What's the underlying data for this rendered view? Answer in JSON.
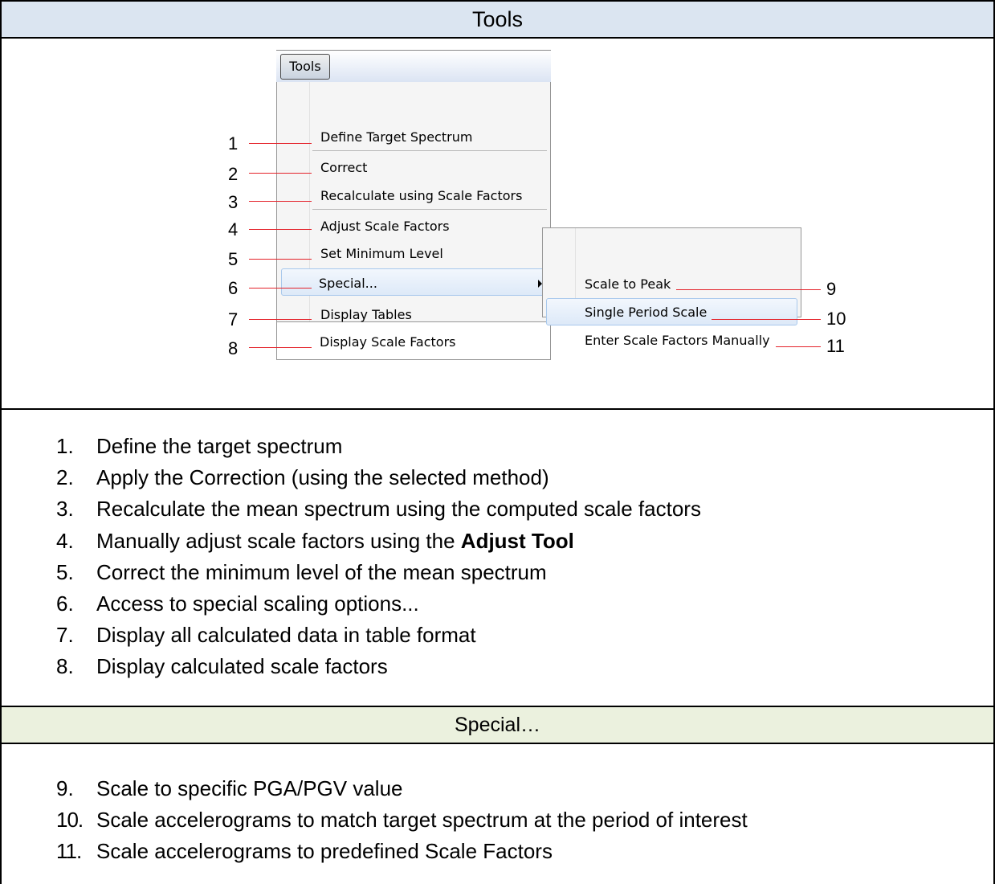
{
  "tools_header": "Tools",
  "special_header": "Special…",
  "menu": {
    "button": "Tools",
    "items": [
      "Define Target Spectrum",
      "Correct",
      "Recalculate using Scale Factors",
      "Adjust Scale Factors",
      "Set Minimum Level",
      "Special...",
      "Display Tables",
      "Display Scale Factors"
    ],
    "submenu": [
      "Scale to Peak",
      "Single Period Scale",
      "Enter Scale Factors Manually"
    ],
    "callouts": [
      "1",
      "2",
      "3",
      "4",
      "5",
      "6",
      "7",
      "8",
      "9",
      "10",
      "11"
    ]
  },
  "descriptions": [
    {
      "num": "1.",
      "text": "Define the target spectrum"
    },
    {
      "num": "2.",
      "text": "Apply the Correction (using the selected method)"
    },
    {
      "num": "3.",
      "text": "Recalculate the mean spectrum using the computed scale factors"
    },
    {
      "num": "4.",
      "text": "Manually adjust scale factors using the ",
      "bold": "Adjust Tool"
    },
    {
      "num": "5.",
      "text": "Correct the minimum level of the mean spectrum"
    },
    {
      "num": "6.",
      "text": "Access to special scaling options..."
    },
    {
      "num": "7.",
      "text": "Display all calculated data in table format"
    },
    {
      "num": "8.",
      "text": "Display calculated scale factors"
    }
  ],
  "special_descriptions": [
    {
      "num": "9.",
      "text": "Scale to specific PGA/PGV value"
    },
    {
      "num": "10.",
      "text": "Scale accelerograms to match target spectrum at the period of interest"
    },
    {
      "num": "11.",
      "text": "Scale accelerograms to predefined Scale Factors"
    }
  ]
}
